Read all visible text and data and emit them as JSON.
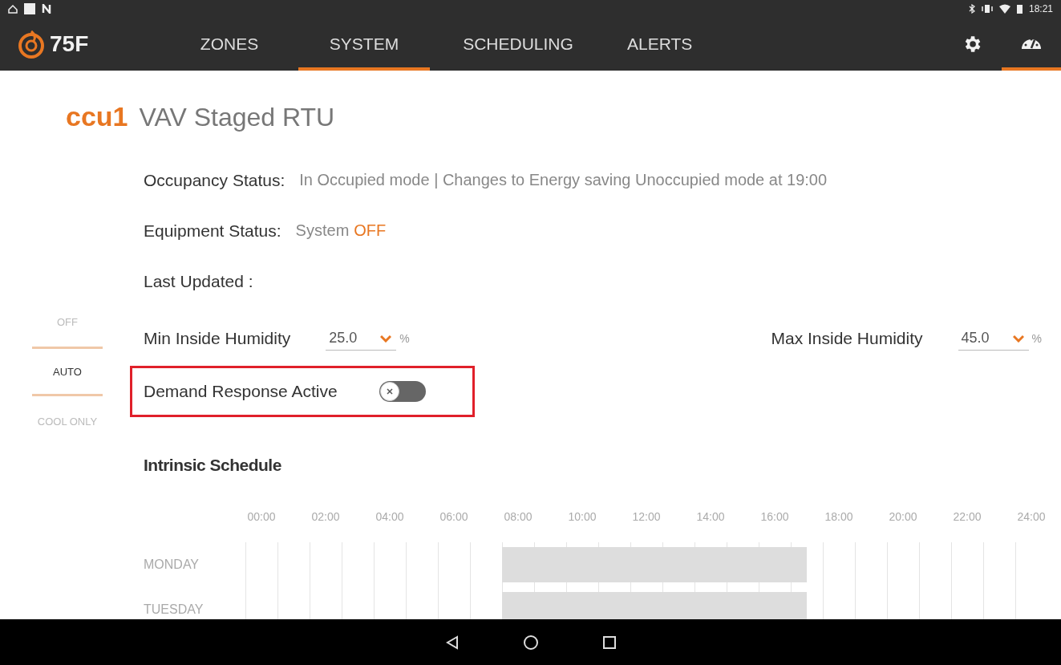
{
  "status_bar": {
    "time": "18:21"
  },
  "nav": {
    "logo": "75F",
    "tabs": [
      {
        "label": "ZONES",
        "selected": false
      },
      {
        "label": "SYSTEM",
        "selected": true
      },
      {
        "label": "SCHEDULING",
        "selected": false
      },
      {
        "label": "ALERTS",
        "selected": false
      }
    ],
    "icon_tabs": [
      {
        "kind": "settings",
        "selected": false
      },
      {
        "kind": "dashboard",
        "selected": true
      }
    ]
  },
  "modes": [
    {
      "label": "OFF",
      "selected": false
    },
    {
      "label": "AUTO",
      "selected": true
    },
    {
      "label": "COOL ONLY",
      "selected": false
    }
  ],
  "header": {
    "id": "ccu1",
    "title": "VAV Staged RTU"
  },
  "status_rows": [
    {
      "label": "Occupancy Status:",
      "parts": [
        {
          "text": "In Occupied mode | Changes to Energy saving Unoccupied mode at 19:00",
          "kind": "plain"
        }
      ]
    },
    {
      "label": "Equipment Status:",
      "parts": [
        {
          "text": "System",
          "kind": "plain"
        },
        {
          "text": "OFF",
          "kind": "accent"
        }
      ]
    },
    {
      "label": "Last Updated :",
      "parts": []
    }
  ],
  "humidity": [
    {
      "label": "Min Inside Humidity",
      "value": "25.0",
      "unit": "%"
    },
    {
      "label": "Max Inside Humidity",
      "value": "45.0",
      "unit": "%"
    }
  ],
  "demand_response": {
    "label": "Demand Response Active",
    "on": false,
    "highlighted": true
  },
  "schedule": {
    "title": "Intrinsic Schedule",
    "hours": [
      "00:00",
      "02:00",
      "04:00",
      "06:00",
      "08:00",
      "10:00",
      "12:00",
      "14:00",
      "16:00",
      "18:00",
      "20:00",
      "22:00",
      "24:00"
    ],
    "days": [
      {
        "label": "MONDAY",
        "occupied": true
      },
      {
        "label": "TUESDAY",
        "occupied": true
      }
    ]
  }
}
